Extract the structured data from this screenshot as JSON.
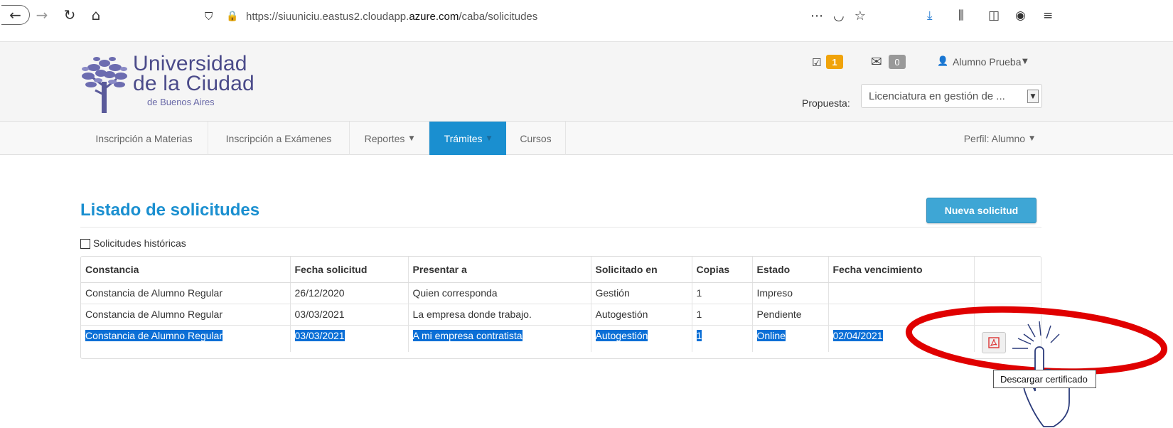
{
  "browser": {
    "url_prefix": "https://siuuniciu.eastus2.cloudapp.",
    "url_domain": "azure.com",
    "url_path": "/caba/solicitudes"
  },
  "header": {
    "logo_line1": "Universidad",
    "logo_line2": "de la Ciudad",
    "logo_line3": "de Buenos Aires",
    "tasks_count": "1",
    "messages_count": "0",
    "user_name": "Alumno Prueba",
    "propuesta_label": "Propuesta:",
    "propuesta_value": "Licenciatura en gestión de ..."
  },
  "nav": {
    "items": [
      {
        "label": "Inscripción a Materias"
      },
      {
        "label": "Inscripción a Exámenes"
      },
      {
        "label": "Reportes"
      },
      {
        "label": "Trámites"
      },
      {
        "label": "Cursos"
      }
    ],
    "perfil": "Perfil: Alumno"
  },
  "main": {
    "title": "Listado de solicitudes",
    "new_button": "Nueva solicitud",
    "historic_label": "Solicitudes históricas",
    "columns": [
      "Constancia",
      "Fecha solicitud",
      "Presentar a",
      "Solicitado en",
      "Copias",
      "Estado",
      "Fecha vencimiento",
      ""
    ],
    "rows": [
      [
        "Constancia de Alumno Regular",
        "26/12/2020",
        "Quien corresponda",
        "Gestión",
        "1",
        "Impreso",
        ""
      ],
      [
        "Constancia de Alumno Regular",
        "03/03/2021",
        "La empresa donde trabajo.",
        "Autogestión",
        "1",
        "Pendiente",
        ""
      ],
      [
        "Constancia de Alumno Regular",
        "03/03/2021",
        "A mi empresa contratista",
        "Autogestión",
        "1",
        "Online",
        "02/04/2021"
      ]
    ],
    "tooltip": "Descargar certificado"
  },
  "colors": {
    "accent": "#1a8fd0",
    "selection": "#0b6fd6",
    "highlight_ring": "#e00000",
    "badge_orange": "#f0a30a"
  },
  "icons": [
    "back-arrow-icon",
    "forward-arrow-icon",
    "reload-icon",
    "home-icon",
    "shield-icon",
    "lock-icon",
    "pocket-icon",
    "star-icon",
    "download-icon",
    "library-icon",
    "sidebar-icon",
    "account-icon",
    "tasks-icon",
    "mail-icon",
    "user-icon",
    "pdf-icon",
    "pointer-hand-icon"
  ]
}
